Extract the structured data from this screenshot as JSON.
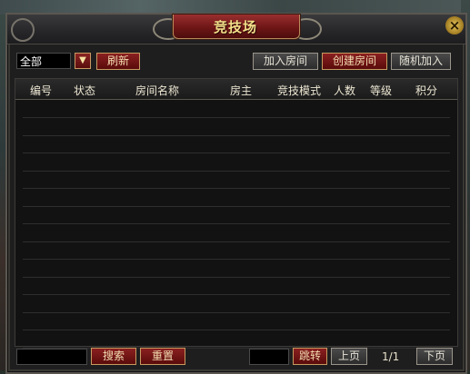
{
  "title": "竞技场",
  "filter": {
    "selected": "全部"
  },
  "buttons": {
    "refresh": "刷新",
    "join_room": "加入房间",
    "create_room": "创建房间",
    "random_join": "随机加入",
    "search": "搜索",
    "reset": "重置",
    "jump": "跳转",
    "prev_page": "上页",
    "next_page": "下页"
  },
  "columns": [
    "编号",
    "状态",
    "房间名称",
    "房主",
    "竞技模式",
    "人数",
    "等级",
    "积分"
  ],
  "rows": [],
  "pagination": {
    "label": "1/1"
  },
  "close_icon": "×",
  "dropdown_icon": "chevron-down-icon"
}
